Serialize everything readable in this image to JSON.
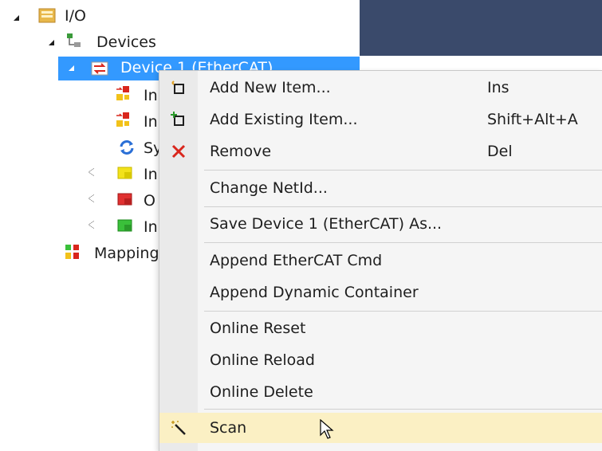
{
  "tree": {
    "root_label": "I/O",
    "devices_label": "Devices",
    "device1_label": "Device 1 (EtherCAT)",
    "child_labels": [
      "In",
      "In",
      "Sy",
      "In",
      "O",
      "In"
    ],
    "mapping_label": "Mapping"
  },
  "menu": {
    "items": [
      {
        "label": "Add New Item...",
        "shortcut": "Ins",
        "icon": "add-new-item-icon"
      },
      {
        "label": "Add Existing Item...",
        "shortcut": "Shift+Alt+A",
        "icon": "add-existing-item-icon"
      },
      {
        "label": "Remove",
        "shortcut": "Del",
        "icon": "remove-x-icon"
      },
      {
        "label": "Change NetId..."
      },
      {
        "label": "Save Device 1 (EtherCAT) As..."
      },
      {
        "label": "Append EtherCAT Cmd"
      },
      {
        "label": "Append Dynamic Container"
      },
      {
        "label": "Online Reset"
      },
      {
        "label": "Online Reload"
      },
      {
        "label": "Online Delete"
      },
      {
        "label": "Scan",
        "icon": "magic-wand-icon",
        "highlighted": true
      }
    ]
  },
  "colors": {
    "selection": "#3399ff",
    "highlight": "#fbf0c4",
    "remove_red": "#d9261c",
    "dark_panel": "#3a4a6b"
  }
}
